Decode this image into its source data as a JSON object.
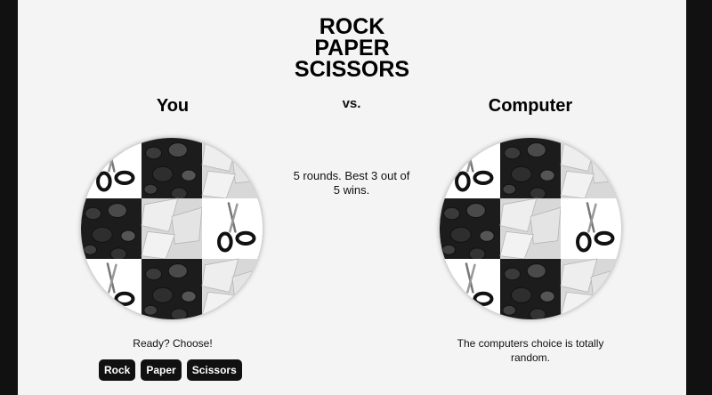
{
  "game": {
    "title_lines": [
      "ROCK",
      "PAPER",
      "SCISSORS"
    ],
    "vs_label": "vs.",
    "rules": "5 rounds. Best 3 out of 5 wins."
  },
  "player": {
    "heading": "You",
    "status": "Ready? Choose!",
    "buttons": {
      "rock": "Rock",
      "paper": "Paper",
      "scissors": "Scissors"
    }
  },
  "computer": {
    "heading": "Computer",
    "status": "The computers choice is totally random."
  },
  "wheel_layout": [
    [
      "scissors",
      "rock",
      "paper"
    ],
    [
      "rock",
      "paper",
      "scissors"
    ],
    [
      "scissors",
      "rock",
      "paper"
    ]
  ],
  "colors": {
    "background": "#f4f4f4",
    "frame": "#111111",
    "button_bg": "#111111",
    "button_text": "#ffffff"
  }
}
